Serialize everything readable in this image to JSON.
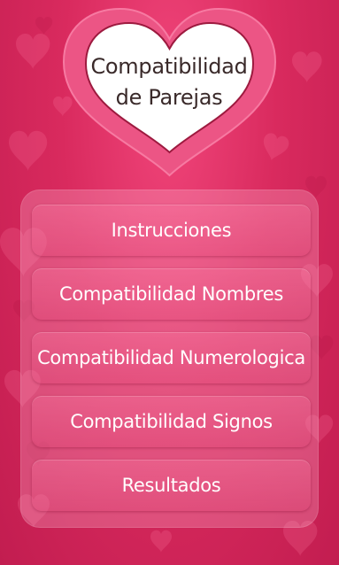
{
  "header": {
    "title_line1": "Compatibilidad",
    "title_line2": "de Parejas"
  },
  "menu": {
    "items": [
      {
        "label": "Instrucciones"
      },
      {
        "label": "Compatibilidad Nombres"
      },
      {
        "label": "Compatibilidad Numerologica"
      },
      {
        "label": "Compatibilidad Signos"
      },
      {
        "label": "Resultados"
      }
    ]
  },
  "colors": {
    "background": "#d92a5e",
    "heart_outer": "#e8507f",
    "heart_inner": "#ffffff",
    "button_text": "#ffffff",
    "title_text": "#3a2a2a"
  }
}
